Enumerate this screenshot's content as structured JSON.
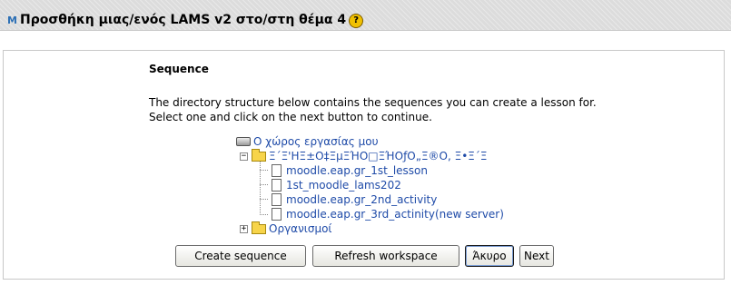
{
  "header": {
    "logo_text": "M",
    "title": "Προσθήκη μιας/ενός LAMS v2 στο/στη θέμα 4",
    "help_glyph": "?"
  },
  "main": {
    "heading": "Sequence",
    "description_line1": "The directory structure below contains the sequences you can create a lesson for.",
    "description_line2": "Select one and click on the next button to continue."
  },
  "tree": {
    "root": {
      "label": "Ο χώρος εργασίας μου",
      "icon": "drive-icon"
    },
    "folder": {
      "label": "Ξ΄Ξ'ΗΞ±Ο‡ΞμΞΉΟ□ΞΉΟƒΟ„Ξ®Ο, Ξ•Ξ΄Ξ",
      "icon": "folder-icon",
      "expander": "−"
    },
    "files": [
      {
        "label": "moodle.eap.gr_1st_lesson"
      },
      {
        "label": "1st_moodle_lams202"
      },
      {
        "label": "moodle.eap.gr_2nd_activity"
      },
      {
        "label": "moodle.eap.gr_3rd_actinity(new server)"
      }
    ],
    "settings": {
      "label": "Οργανισμοί",
      "icon": "folder-icon",
      "expander": "+"
    }
  },
  "buttons": {
    "create": "Create sequence",
    "refresh": "Refresh workspace",
    "cancel": "Άκυρο",
    "next": "Next"
  },
  "colors": {
    "link": "#1f4ba8",
    "header_bg": "#dcdcdc",
    "help_icon": "#f0c000",
    "folder": "#f7d44a"
  }
}
